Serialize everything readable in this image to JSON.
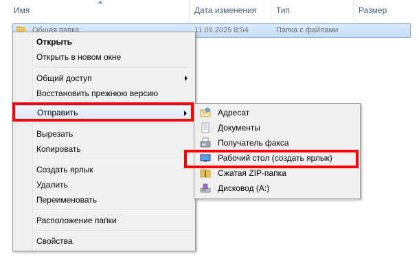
{
  "columns": {
    "name": "Имя",
    "date_modified": "Дата изменения",
    "type": "Тип",
    "size": "Размер"
  },
  "selected_item": {
    "name": "Общая папка",
    "date": "11.09.2025 8:54",
    "type": "Папка с файлами",
    "icon": "folder-icon"
  },
  "context_menu": {
    "open": "Открыть",
    "open_new_window": "Открыть в новом окне",
    "share": "Общий доступ",
    "restore_previous": "Восстановить прежнюю версию",
    "send_to": "Отправить",
    "cut": "Вырезать",
    "copy": "Копировать",
    "create_shortcut": "Создать ярлык",
    "delete": "Удалить",
    "rename": "Переименовать",
    "folder_location": "Расположение папки",
    "properties": "Свойства"
  },
  "send_to_menu": [
    {
      "label": "Адресат",
      "icon": "mail-recipient-icon"
    },
    {
      "label": "Документы",
      "icon": "documents-icon"
    },
    {
      "label": "Получатель факса",
      "icon": "fax-icon"
    },
    {
      "label": "Рабочий стол (создать ярлык)",
      "icon": "desktop-icon"
    },
    {
      "label": "Сжатая ZIP-папка",
      "icon": "zip-folder-icon"
    },
    {
      "label": "Дисковод (A:)",
      "icon": "floppy-drive-icon"
    }
  ],
  "highlight_color": "#ff0000"
}
